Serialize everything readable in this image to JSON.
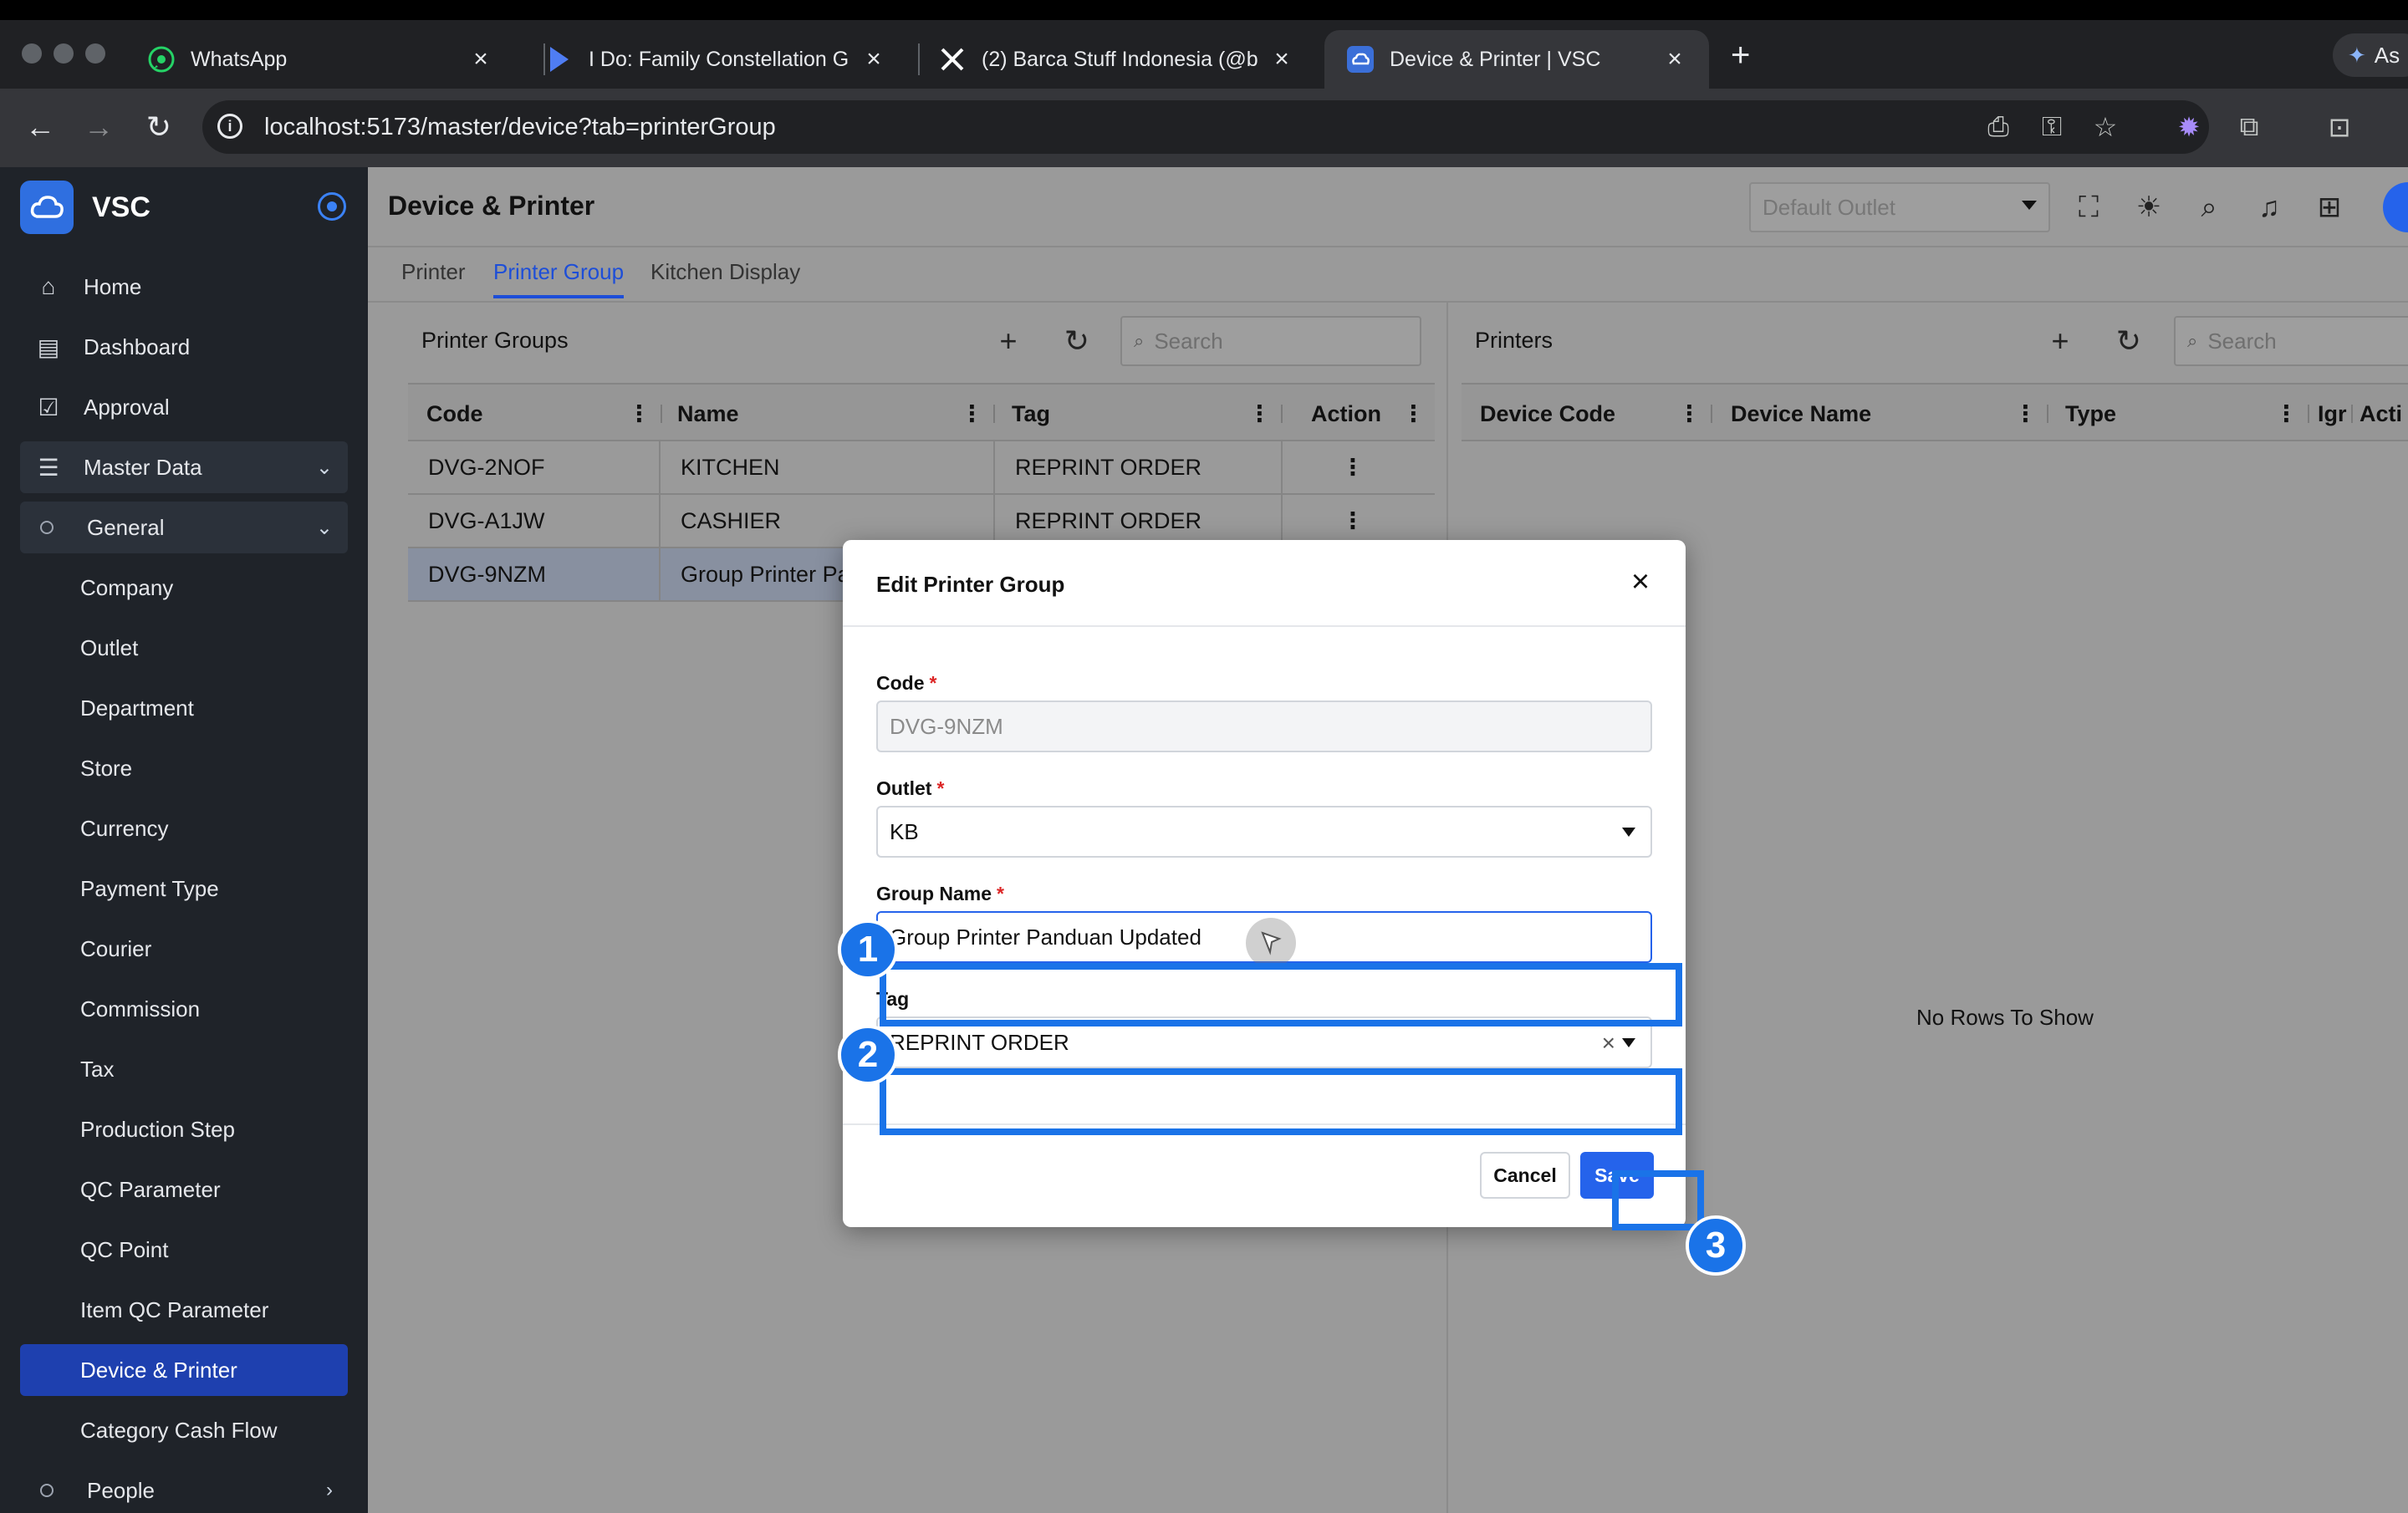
{
  "browser": {
    "tabs": [
      {
        "title": "WhatsApp",
        "icon": "whatsapp-icon"
      },
      {
        "title": "I Do: Family Constellation Gui",
        "icon": "play-icon"
      },
      {
        "title": "(2) Barca Stuff Indonesia (@b",
        "icon": "x-logo-icon"
      },
      {
        "title": "Device & Printer | VSC",
        "icon": "cloud-icon"
      }
    ],
    "ask_label": "As",
    "url": "localhost:5173/master/device?tab=printerGroup"
  },
  "app": {
    "name": "VSC",
    "page_title": "Device & Printer",
    "outlet_placeholder": "Default Outlet"
  },
  "sidebar": {
    "items": [
      {
        "label": "Home",
        "icon": "home-icon"
      },
      {
        "label": "Dashboard",
        "icon": "dashboard-icon"
      },
      {
        "label": "Approval",
        "icon": "approval-icon"
      },
      {
        "label": "Master Data",
        "icon": "database-icon"
      },
      {
        "label": "General",
        "icon": "circle-icon"
      },
      {
        "label": "Company"
      },
      {
        "label": "Outlet"
      },
      {
        "label": "Department"
      },
      {
        "label": "Store"
      },
      {
        "label": "Currency"
      },
      {
        "label": "Payment Type"
      },
      {
        "label": "Courier"
      },
      {
        "label": "Commission"
      },
      {
        "label": "Tax"
      },
      {
        "label": "Production Step"
      },
      {
        "label": "QC Parameter"
      },
      {
        "label": "QC Point"
      },
      {
        "label": "Item QC Parameter"
      },
      {
        "label": "Device & Printer"
      },
      {
        "label": "Category Cash Flow"
      },
      {
        "label": "People",
        "icon": "circle-icon"
      }
    ]
  },
  "subtabs": [
    "Printer",
    "Printer Group",
    "Kitchen Display"
  ],
  "printer_groups": {
    "title": "Printer Groups",
    "search_placeholder": "Search",
    "columns": [
      "Code",
      "Name",
      "Tag",
      "Action"
    ],
    "rows": [
      {
        "code": "DVG-2NOF",
        "name": "KITCHEN",
        "tag": "REPRINT ORDER"
      },
      {
        "code": "DVG-A1JW",
        "name": "CASHIER",
        "tag": "REPRINT ORDER"
      },
      {
        "code": "DVG-9NZM",
        "name": "Group Printer Pa",
        "tag": ""
      }
    ]
  },
  "printers": {
    "title": "Printers",
    "search_placeholder": "Search",
    "columns": [
      "Device Code",
      "Device Name",
      "Type",
      "Igr",
      "Acti"
    ],
    "empty_text": "No Rows To Show"
  },
  "modal": {
    "title": "Edit Printer Group",
    "code_label": "Code",
    "code_value": "DVG-9NZM",
    "outlet_label": "Outlet",
    "outlet_value": "KB",
    "group_name_label": "Group Name",
    "group_name_value": "Group Printer Panduan Updated",
    "tag_label": "Tag",
    "tag_value": "REPRINT ORDER",
    "required_mark": "*",
    "cancel_label": "Cancel",
    "save_label": "Save"
  },
  "annotations": [
    "1",
    "2",
    "3"
  ],
  "colors": {
    "accent": "#2563eb",
    "annotation": "#1a73e8",
    "sidebar_bg": "#1f2329",
    "sidebar_selected": "#1e40af",
    "required": "#dc2626"
  }
}
